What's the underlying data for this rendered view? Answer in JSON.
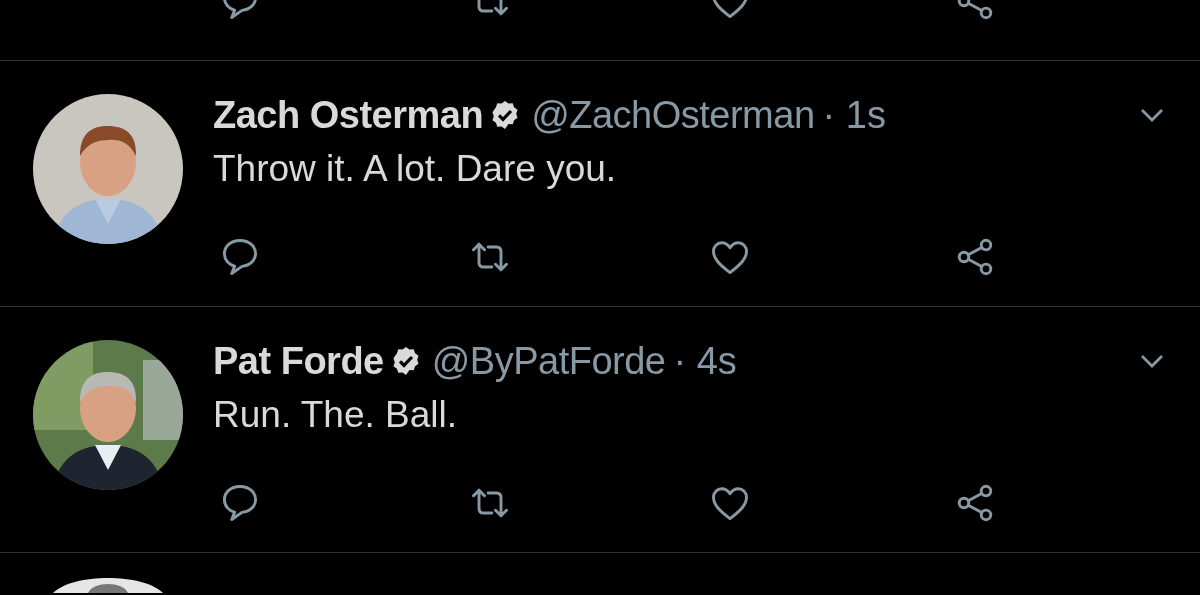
{
  "tweets": [
    {
      "name": "Zach Osterman",
      "verified": true,
      "handle": "@ZachOsterman",
      "time": "· 1s",
      "text": "Throw it. A lot. Dare you."
    },
    {
      "name": "Pat Forde",
      "verified": true,
      "handle": "@ByPatForde",
      "time": "· 4s",
      "text": "Run. The. Ball."
    }
  ]
}
